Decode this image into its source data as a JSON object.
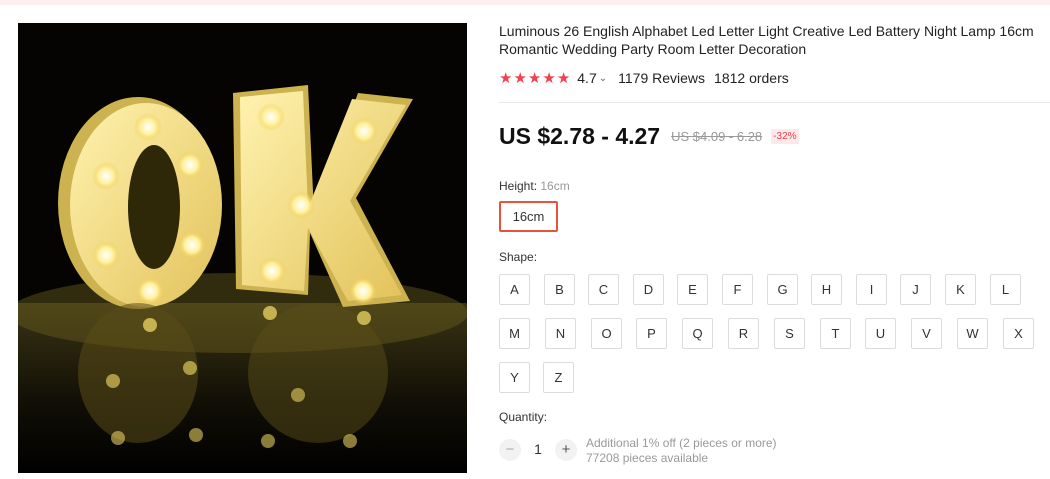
{
  "product": {
    "title": "Luminous 26 English Alphabet Led Letter Light Creative Led Battery Night Lamp 16cm Romantic Wedding Party Room Letter Decoration",
    "image_alt": "OK"
  },
  "rating": {
    "stars": 5,
    "value": "4.7",
    "reviews": "1179 Reviews",
    "orders": "1812 orders"
  },
  "price": {
    "current": "US $2.78 - 4.27",
    "original": "US $4.09 - 6.28",
    "discount": "-32%"
  },
  "height": {
    "label": "Height:",
    "selected_value": "16cm",
    "options": [
      "16cm"
    ]
  },
  "shape": {
    "label": "Shape:",
    "options": [
      "A",
      "B",
      "C",
      "D",
      "E",
      "F",
      "G",
      "H",
      "I",
      "J",
      "K",
      "L",
      "M",
      "N",
      "O",
      "P",
      "Q",
      "R",
      "S",
      "T",
      "U",
      "V",
      "W",
      "X",
      "Y",
      "Z"
    ]
  },
  "quantity": {
    "label": "Quantity:",
    "value": "1",
    "minus": "−",
    "plus": "+",
    "note1": "Additional 1% off (2 pieces or more)",
    "note2": "77208 pieces available"
  },
  "colors": {
    "accent": "#f0424e",
    "selected_border": "#e8533c"
  }
}
